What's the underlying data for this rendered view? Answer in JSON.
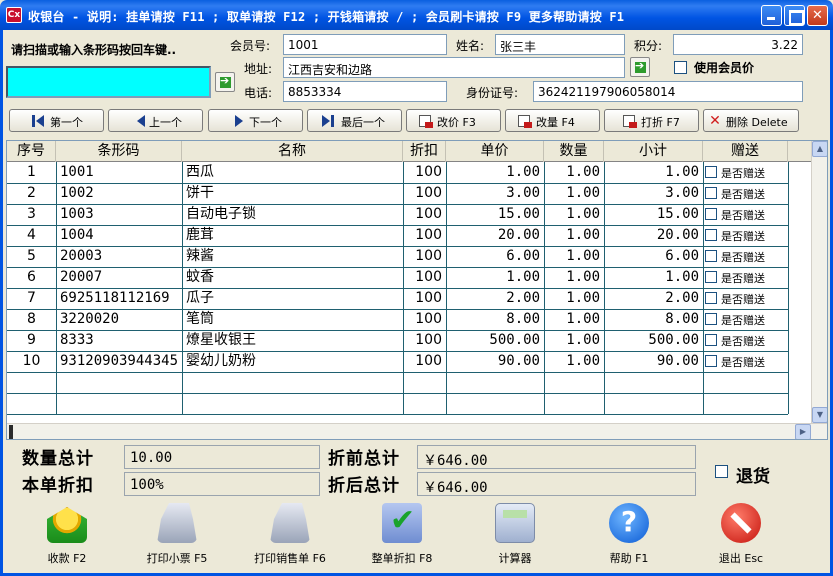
{
  "window": {
    "title": "收银台 - 说明: 挂单请按 F11 ; 取单请按 F12 ; 开钱箱请按 / ; 会员刷卡请按 F9   更多帮助请按 F1",
    "icon_text": "Cx"
  },
  "scan": {
    "prompt": "请扫描或输入条形码按回车键..",
    "value": ""
  },
  "member": {
    "id_label": "会员号:",
    "id_value": "1001",
    "name_label": "姓名:",
    "name_value": "张三丰",
    "points_label": "积分:",
    "points_value": "3.22",
    "address_label": "地址:",
    "address_value": "江西吉安和边路",
    "phone_label": "电话:",
    "phone_value": "8853334",
    "idcard_label": "身份证号:",
    "idcard_value": "362421197906058014",
    "use_price_label": "使用会员价"
  },
  "toolbar": {
    "first": "第一个",
    "prev": "上一个",
    "next": "下一个",
    "last": "最后一个",
    "change_price": "改价 F3",
    "change_qty": "改量 F4",
    "discount": "打折 F7",
    "delete": "删除 Delete"
  },
  "table": {
    "headers": [
      "序号",
      "条形码",
      "名称",
      "折扣",
      "单价",
      "数量",
      "小计",
      "赠送"
    ],
    "gift_label": "是否赠送",
    "rows": [
      {
        "no": "1",
        "barcode": "1001",
        "name": "西瓜",
        "discount": "100",
        "price": "1.00",
        "qty": "1.00",
        "subtotal": "1.00"
      },
      {
        "no": "2",
        "barcode": "1002",
        "name": "饼干",
        "discount": "100",
        "price": "3.00",
        "qty": "1.00",
        "subtotal": "3.00"
      },
      {
        "no": "3",
        "barcode": "1003",
        "name": "自动电子锁",
        "discount": "100",
        "price": "15.00",
        "qty": "1.00",
        "subtotal": "15.00"
      },
      {
        "no": "4",
        "barcode": "1004",
        "name": "鹿茸",
        "discount": "100",
        "price": "20.00",
        "qty": "1.00",
        "subtotal": "20.00"
      },
      {
        "no": "5",
        "barcode": "20003",
        "name": "辣酱",
        "discount": "100",
        "price": "6.00",
        "qty": "1.00",
        "subtotal": "6.00"
      },
      {
        "no": "6",
        "barcode": "20007",
        "name": "蚊香",
        "discount": "100",
        "price": "1.00",
        "qty": "1.00",
        "subtotal": "1.00"
      },
      {
        "no": "7",
        "barcode": "6925118112169",
        "name": "瓜子",
        "discount": "100",
        "price": "2.00",
        "qty": "1.00",
        "subtotal": "2.00"
      },
      {
        "no": "8",
        "barcode": "3220020",
        "name": "笔筒",
        "discount": "100",
        "price": "8.00",
        "qty": "1.00",
        "subtotal": "8.00"
      },
      {
        "no": "9",
        "barcode": "8333",
        "name": "燎星收银王",
        "discount": "100",
        "price": "500.00",
        "qty": "1.00",
        "subtotal": "500.00"
      },
      {
        "no": "10",
        "barcode": "93120903944345",
        "name": "婴幼儿奶粉",
        "discount": "100",
        "price": "90.00",
        "qty": "1.00",
        "subtotal": "90.00"
      }
    ]
  },
  "totals": {
    "qty_label": "数量总计",
    "qty_value": "10.00",
    "bill_discount_label": "本单折扣",
    "bill_discount_value": "100%",
    "before_label": "折前总计",
    "before_value": "￥646.00",
    "after_label": "折后总计",
    "after_value": "￥646.00",
    "return_label": "退货"
  },
  "actions": {
    "checkout": "收款 F2",
    "print_ticket": "打印小票 F5",
    "print_invoice": "打印销售单 F6",
    "bill_discount": "整单折扣 F8",
    "calculator": "计算器",
    "help": "帮助 F1",
    "exit": "退出 Esc"
  }
}
